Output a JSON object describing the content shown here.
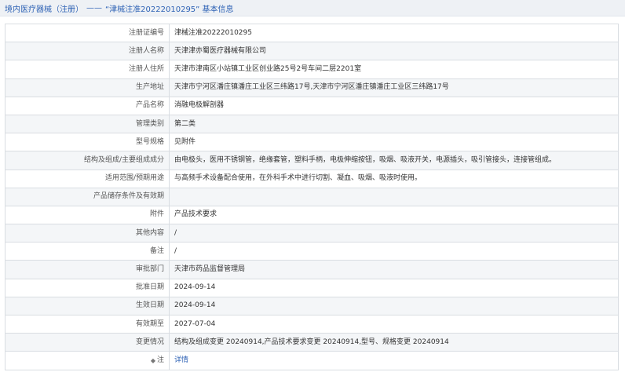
{
  "header": {
    "link_label": "境内医疗器械（注册）",
    "separator": "——",
    "title": "“津械注准20222010295” 基本信息"
  },
  "rows": [
    {
      "label": "注册证编号",
      "value": "津械注准20222010295"
    },
    {
      "label": "注册人名称",
      "value": "天津津亦蜀医疗器械有限公司"
    },
    {
      "label": "注册人住所",
      "value": "天津市津南区小站镇工业区创业路25号2号车间二层2201室"
    },
    {
      "label": "生产地址",
      "value": "天津市宁河区潘庄镇潘庄工业区三纬路17号,天津市宁河区潘庄镇潘庄工业区三纬路17号"
    },
    {
      "label": "产品名称",
      "value": "消融电极解剖器"
    },
    {
      "label": "管理类别",
      "value": "第二类"
    },
    {
      "label": "型号规格",
      "value": "见附件"
    },
    {
      "label": "结构及组成/主要组成成分",
      "value": "由电极头，医用不锈钢管，绝缘套管，塑料手柄，电极伸缩按钮，吸烟、吸液开关，电源插头，吸引管接头，连接管组成。"
    },
    {
      "label": "适用范围/预期用途",
      "value": "与高频手术设备配合使用，在外科手术中进行切割、凝血、吸烟、吸液时使用。"
    },
    {
      "label": "产品储存条件及有效期",
      "value": ""
    },
    {
      "label": "附件",
      "value": "产品技术要求"
    },
    {
      "label": "其他内容",
      "value": "/"
    },
    {
      "label": "备注",
      "value": "/"
    },
    {
      "label": "审批部门",
      "value": "天津市药品监督管理局"
    },
    {
      "label": "批准日期",
      "value": "2024-09-14"
    },
    {
      "label": "生效日期",
      "value": "2024-09-14"
    },
    {
      "label": "有效期至",
      "value": "2027-07-04"
    },
    {
      "label": "变更情况",
      "value": "结构及组成变更 20240914,产品技术要求变更 20240914,型号、规格变更 20240914"
    }
  ],
  "note_row": {
    "label": "注",
    "value": "详情"
  },
  "icons": {
    "header": "document-icon",
    "note": "note-icon"
  }
}
